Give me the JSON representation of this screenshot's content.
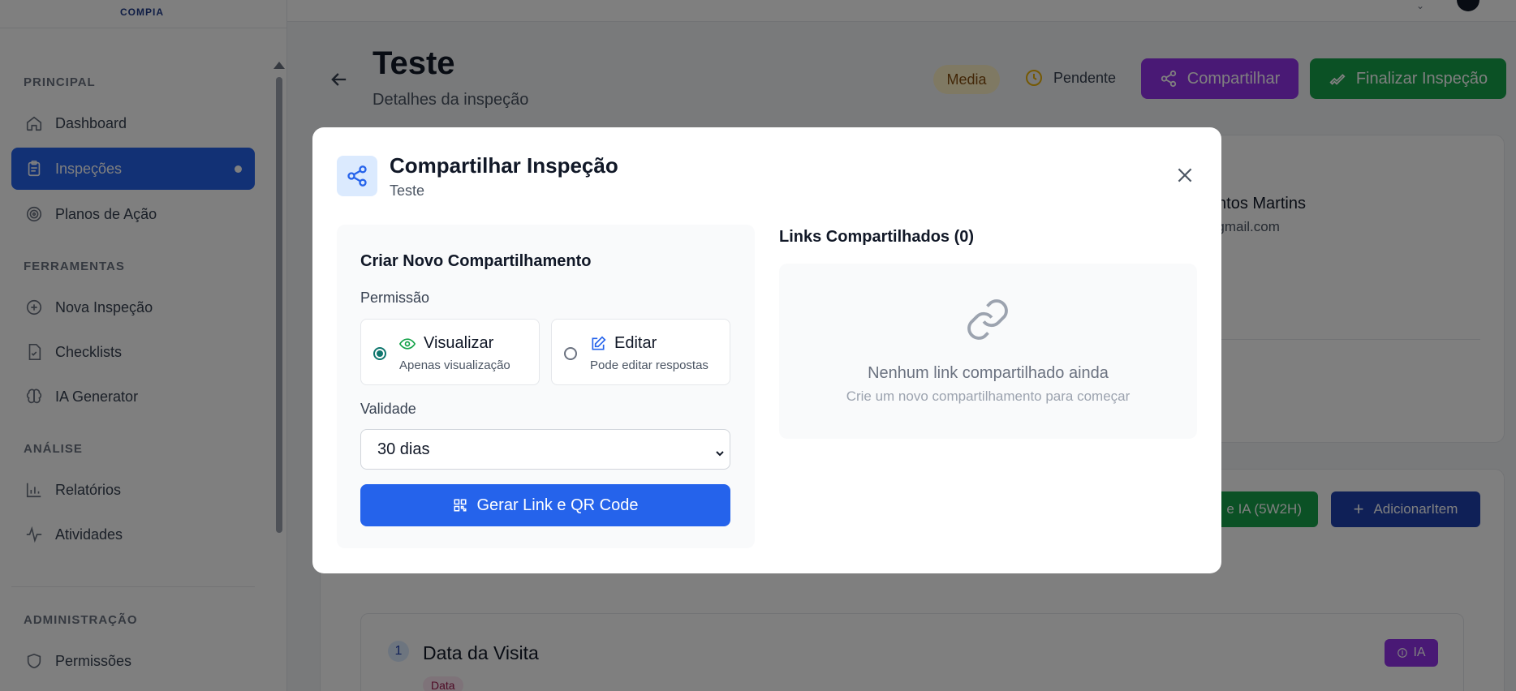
{
  "sidebar": {
    "logo": "COMPIA",
    "sections": {
      "principal": "PRINCIPAL",
      "ferramentas": "FERRAMENTAS",
      "analise": "ANÁLISE",
      "administracao": "ADMINISTRAÇÃO"
    },
    "items": [
      {
        "label": "Dashboard",
        "icon": "home-icon"
      },
      {
        "label": "Inspeções",
        "icon": "clipboard-icon",
        "active": true
      },
      {
        "label": "Planos de Ação",
        "icon": "target-icon"
      },
      {
        "label": "Nova Inspeção",
        "icon": "plus-circle-icon"
      },
      {
        "label": "Checklists",
        "icon": "file-check-icon"
      },
      {
        "label": "IA Generator",
        "icon": "brain-icon"
      },
      {
        "label": "Relatórios",
        "icon": "bar-chart-icon"
      },
      {
        "label": "Atividades",
        "icon": "activity-icon"
      },
      {
        "label": "Permissões",
        "icon": "shield-icon"
      }
    ]
  },
  "header": {
    "title": "Teste",
    "subtitle": "Detalhes da inspeção",
    "priority_badge": "Media",
    "status": "Pendente",
    "share_button": "Compartilhar",
    "finish_button": "Finalizar Inspeção"
  },
  "background": {
    "inspector_name": "s Santos Martins",
    "inspector_email": "m@gmail.com",
    "ia_plan_button": "e IA (5W2H)",
    "add_item_button": "AdicionarItem",
    "item": {
      "number": "1",
      "title": "Data da Visita",
      "tag": "Data",
      "ia_button": "IA"
    }
  },
  "modal": {
    "title": "Compartilhar Inspeção",
    "subtitle": "Teste",
    "create_section": {
      "title": "Criar Novo Compartilhamento",
      "permission_label": "Permissão",
      "options": [
        {
          "title": "Visualizar",
          "desc": "Apenas visualização",
          "checked": true
        },
        {
          "title": "Editar",
          "desc": "Pode editar respostas",
          "checked": false
        }
      ],
      "validity_label": "Validade",
      "validity_value": "30 dias",
      "generate_button": "Gerar Link e QR Code"
    },
    "links_section": {
      "title": "Links Compartilhados (0)",
      "empty_title": "Nenhum link compartilhado ainda",
      "empty_subtitle": "Crie um novo compartilhamento para começar"
    }
  },
  "colors": {
    "primary": "#2563eb",
    "purple": "#9333ea",
    "green": "#16a34a",
    "overlay": "rgba(0,0,0,0.5)"
  }
}
